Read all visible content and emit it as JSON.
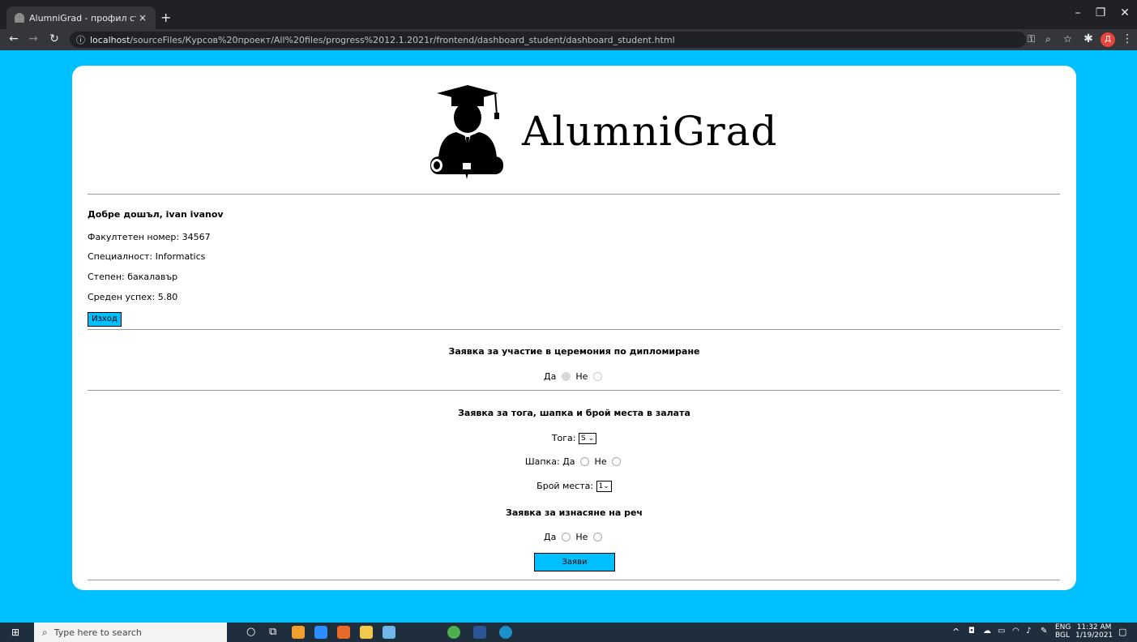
{
  "browser": {
    "tab_title": "AlumniGrad - профил студент",
    "tab_close": "×",
    "new_tab": "+",
    "url_host": "localhost",
    "url_path": "/sourceFiles/Курсов%20проект/All%20files/progress%2012.1.2021r/frontend/dashboard_student/dashboard_student.html",
    "info_icon": "ⓘ",
    "profile_initial": "Д"
  },
  "page": {
    "brand": "AlumniGrad",
    "welcome": "Добре дошъл, ivan ivanov",
    "faculty_number": "Факултетен номер: 34567",
    "specialty": "Специалност: Informatics",
    "degree": "Степен: бакалавър",
    "gpa": "Среден успех: 5.80",
    "logout_label": "Изход",
    "ceremony_heading": "Заявка за участие в церемония по дипломиране",
    "ceremony_yes": "Да",
    "ceremony_no": "Не",
    "gown_heading": "Заявка за тога, шапка и брой места в залата",
    "gown_label": "Тога:",
    "gown_value": "S",
    "cap_label": "Шапка:",
    "cap_yes": "Да",
    "cap_no": "Не",
    "seats_label": "Брой места:",
    "seats_value": "1",
    "speech_heading": "Заявка за изнасяне на реч",
    "speech_yes": "Да",
    "speech_no": "Не",
    "submit_label": "Заяви"
  },
  "taskbar": {
    "search_placeholder": "Type here to search",
    "lang_top": "ENG",
    "lang_bottom": "BGL",
    "time": "11:32 AM",
    "date": "1/19/2021"
  },
  "colors": {
    "page_bg": "#00bfff",
    "button_bg": "#00bfff"
  }
}
